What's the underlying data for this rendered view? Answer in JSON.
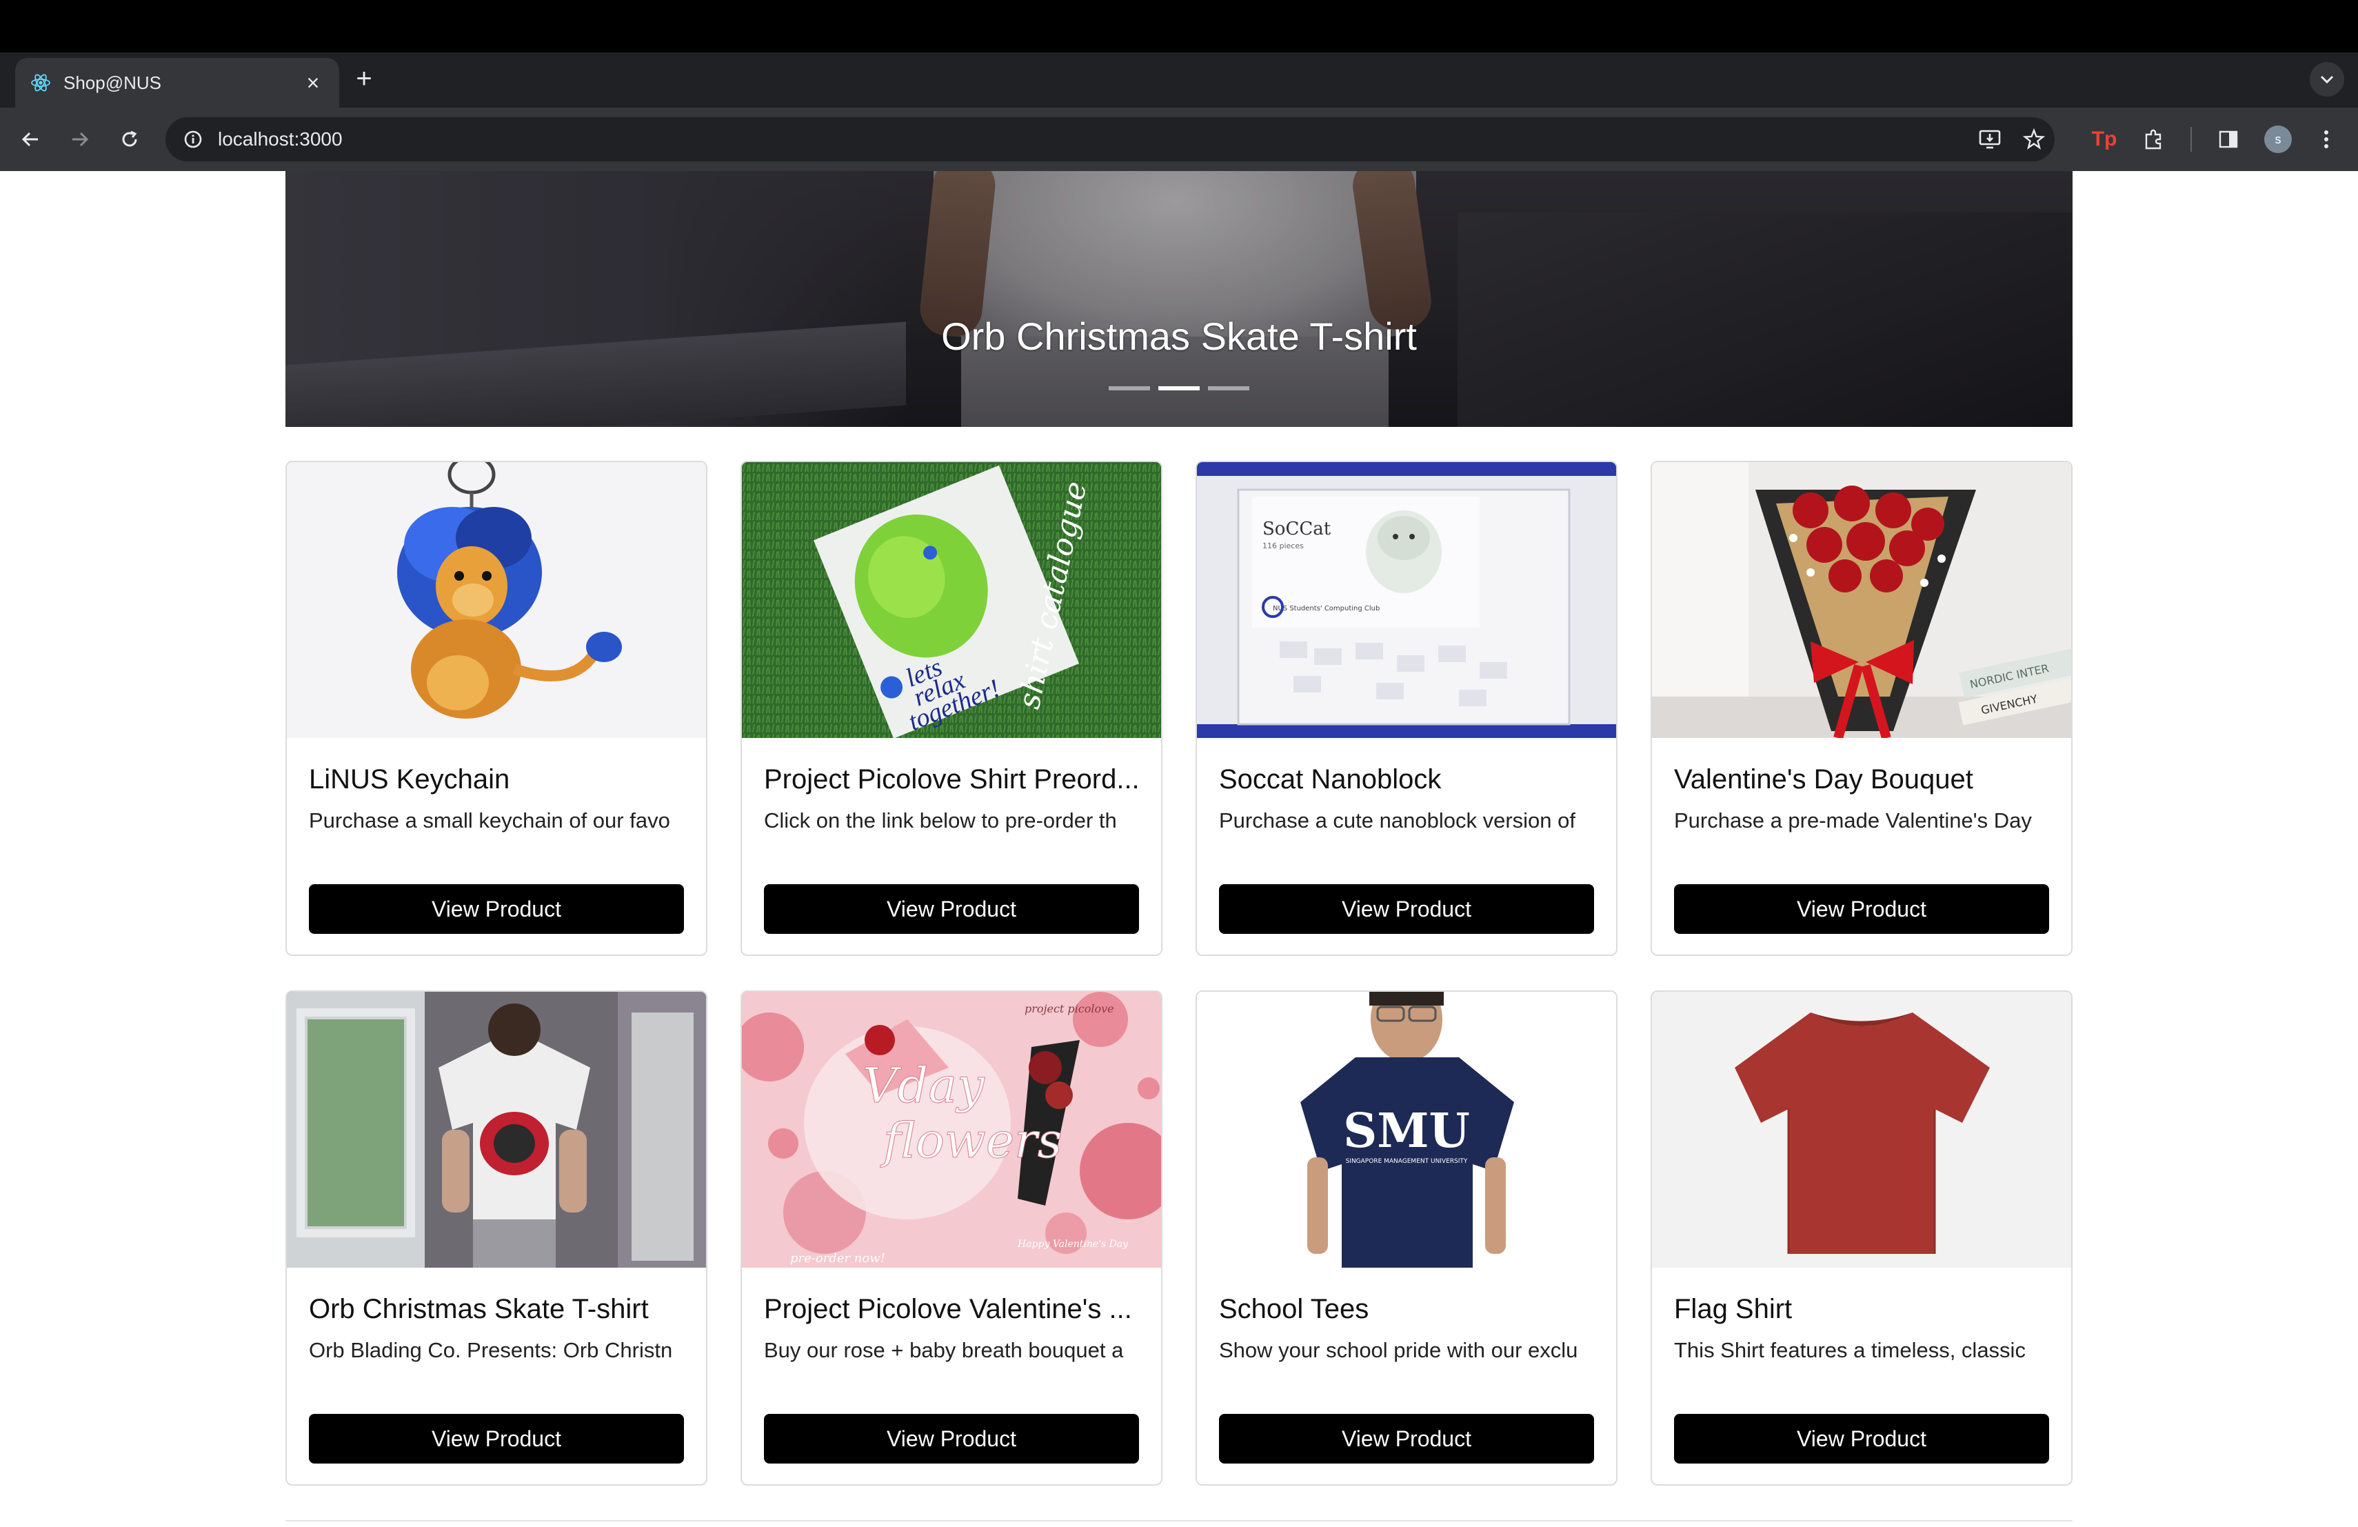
{
  "browser": {
    "tab_title": "Shop@NUS",
    "url": "localhost:3000"
  },
  "hero": {
    "caption": "Orb Christmas Skate T-shirt",
    "slide_count": 3,
    "active_slide": 2
  },
  "products": [
    {
      "title": "LiNUS Keychain",
      "description": "Purchase a small keychain of our favo",
      "button": "View Product"
    },
    {
      "title": "Project Picolove Shirt Preord...",
      "description": "Click on the link below to pre-order th",
      "button": "View Product"
    },
    {
      "title": "Soccat Nanoblock",
      "description": "Purchase a cute nanoblock version of",
      "button": "View Product"
    },
    {
      "title": "Valentine's Day Bouquet",
      "description": "Purchase a pre-made Valentine's Day",
      "button": "View Product"
    },
    {
      "title": "Orb Christmas Skate T-shirt",
      "description": "Orb Blading Co. Presents: Orb Christn",
      "button": "View Product"
    },
    {
      "title": "Project Picolove Valentine's ...",
      "description": "Buy our rose + baby breath bouquet a",
      "button": "View Product"
    },
    {
      "title": "School Tees",
      "description": "Show your school pride with our exclu",
      "button": "View Product"
    },
    {
      "title": "Flag Shirt",
      "description": "This Shirt features a timeless, classic",
      "button": "View Product"
    }
  ],
  "image_text": {
    "catalogue_line1": "lets",
    "catalogue_line2": "relax",
    "catalogue_line3": "together!",
    "catalogue_script": "shirt catalogue",
    "soccat_name": "SoCCat",
    "soccat_pieces": "116 pieces",
    "soccat_club": "NUS Students' Computing Club",
    "book_text": "NORDIC INTER",
    "book_brand": "GIVENCHY",
    "vday_line1": "Vday",
    "vday_line2": "flowers",
    "vday_tag": "project picolove",
    "vday_footer": "pre-order now!",
    "vday_wish": "Happy Valentine's Day",
    "smu_logo": "SMU",
    "smu_sub": "SINGAPORE MANAGEMENT UNIVERSITY"
  },
  "colors": {
    "accent_button": "#000000",
    "page_bg": "#ffffff",
    "chrome_dark": "#202124",
    "chrome_toolbar": "#35363a"
  },
  "icons": [
    "react-favicon-icon",
    "close-icon",
    "plus-icon",
    "chevron-down-icon",
    "back-arrow-icon",
    "forward-arrow-icon",
    "reload-icon",
    "info-icon",
    "install-app-icon",
    "star-icon",
    "tp-extension-icon",
    "puzzle-icon",
    "sidepanel-icon",
    "avatar",
    "more-vert-icon"
  ]
}
